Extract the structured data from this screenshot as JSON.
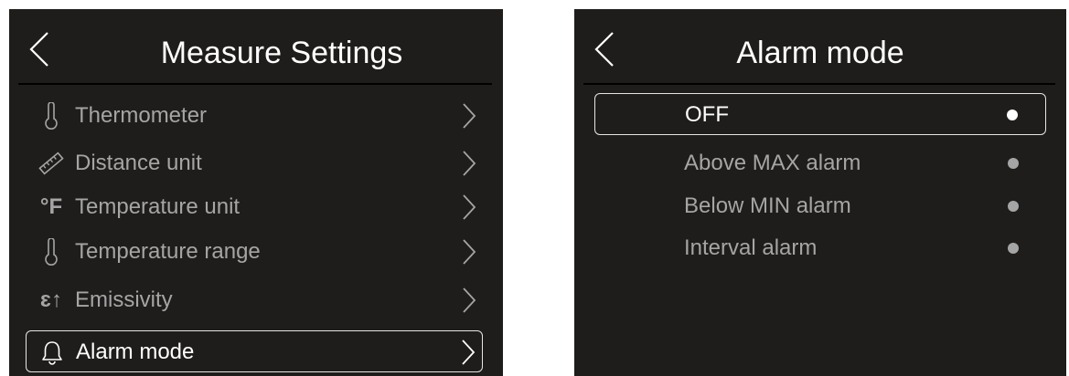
{
  "colors": {
    "screen_bg": "#1f1d1b",
    "text_active": "#ffffff",
    "text_inactive": "#a5a5a5",
    "selection_border": "#e6e6e6"
  },
  "left_screen": {
    "title": "Measure Settings",
    "back_icon": "chevron-left-icon",
    "items": [
      {
        "icon": "thermometer-icon",
        "label": "Thermometer",
        "selected": false
      },
      {
        "icon": "ruler-icon",
        "label": "Distance unit",
        "selected": false
      },
      {
        "icon": "fahrenheit-icon",
        "glyph": "°F",
        "label": "Temperature unit",
        "selected": false
      },
      {
        "icon": "thermometer-icon",
        "label": "Temperature range",
        "selected": false
      },
      {
        "icon": "emissivity-icon",
        "glyph": "ɛ↑",
        "label": "Emissivity",
        "selected": false
      },
      {
        "icon": "bell-icon",
        "label": "Alarm mode",
        "selected": true
      }
    ]
  },
  "right_screen": {
    "title": "Alarm mode",
    "back_icon": "chevron-left-icon",
    "options": [
      {
        "label": "OFF",
        "selected": true
      },
      {
        "label": "Above MAX alarm",
        "selected": false
      },
      {
        "label": "Below MIN alarm",
        "selected": false
      },
      {
        "label": "Interval alarm",
        "selected": false
      }
    ]
  }
}
